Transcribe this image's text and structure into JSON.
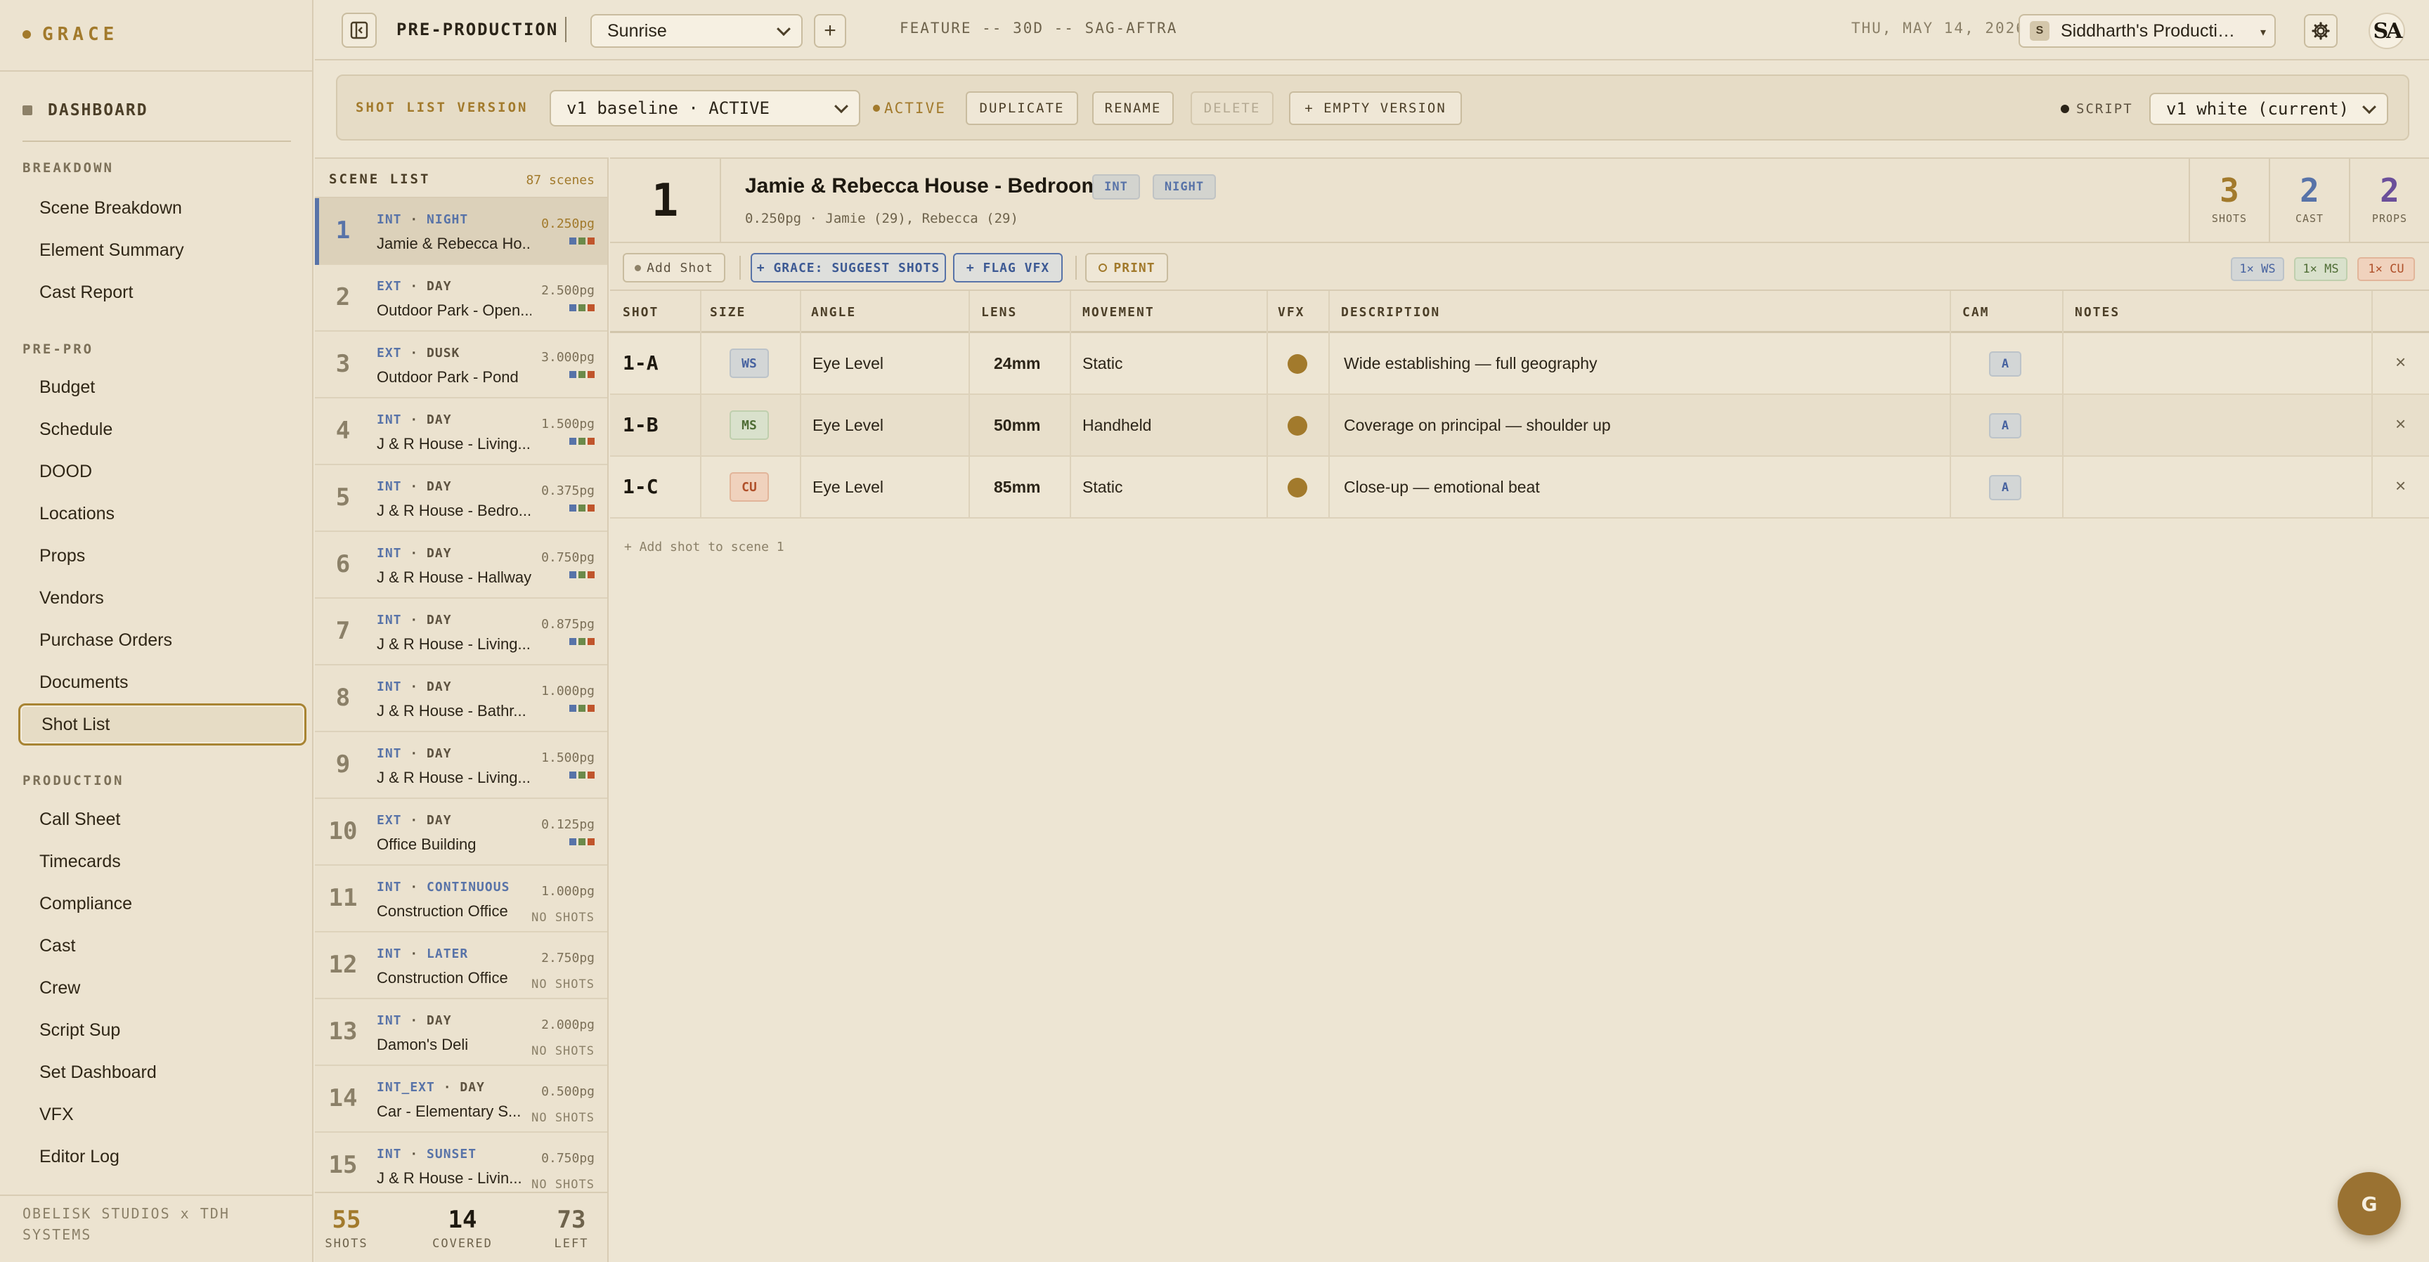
{
  "app": {
    "brand": "GRACE",
    "dashboard": "DASHBOARD"
  },
  "sidebar": {
    "sections": [
      {
        "title": "BREAKDOWN",
        "items": [
          "Scene Breakdown",
          "Element Summary",
          "Cast Report"
        ]
      },
      {
        "title": "PRE-PRO",
        "items": [
          "Budget",
          "Schedule",
          "DOOD",
          "Locations",
          "Props",
          "Vendors",
          "Purchase Orders",
          "Documents",
          "Shot List"
        ]
      },
      {
        "title": "PRODUCTION",
        "items": [
          "Call Sheet",
          "Timecards",
          "Compliance",
          "Cast",
          "Crew",
          "Script Sup",
          "Set Dashboard",
          "VFX",
          "Editor Log"
        ]
      }
    ],
    "active_item": "Shot List",
    "footer": "OBELISK STUDIOS x TDH SYSTEMS"
  },
  "topbar": {
    "section": "PRE-PRODUCTION",
    "project": "Sunrise",
    "add_label": "+",
    "feature": "FEATURE -- 30D -- SAG-AFTRA",
    "date": "THU, MAY 14, 2026",
    "production_initial": "S",
    "production": "Siddharth's Producti…",
    "production_caret": "▾",
    "user_initials": "SA",
    "icons": [
      "sidebar-toggle-icon",
      "gear-icon"
    ]
  },
  "version_bar": {
    "label": "SHOT LIST VERSION",
    "version": "v1 baseline · ACTIVE",
    "status": "ACTIVE",
    "buttons": {
      "duplicate": "DUPLICATE",
      "rename": "RENAME",
      "delete": "DELETE",
      "empty_version": "+ EMPTY VERSION"
    },
    "script_label": "SCRIPT",
    "script": "v1 white (current)"
  },
  "scene_list": {
    "title": "SCENE LIST",
    "count": "87 scenes",
    "scenes": [
      {
        "num": "1",
        "ie": "INT",
        "tod": "NIGHT",
        "name": "Jamie & Rebecca Ho...",
        "pages": "0.250pg",
        "status": "bars"
      },
      {
        "num": "2",
        "ie": "EXT",
        "tod": "DAY",
        "name": "Outdoor Park - Open...",
        "pages": "2.500pg",
        "status": "bars"
      },
      {
        "num": "3",
        "ie": "EXT",
        "tod": "DUSK",
        "name": "Outdoor Park - Pond",
        "pages": "3.000pg",
        "status": "bars"
      },
      {
        "num": "4",
        "ie": "INT",
        "tod": "DAY",
        "name": "J & R House - Living...",
        "pages": "1.500pg",
        "status": "bars"
      },
      {
        "num": "5",
        "ie": "INT",
        "tod": "DAY",
        "name": "J & R House - Bedro...",
        "pages": "0.375pg",
        "status": "bars"
      },
      {
        "num": "6",
        "ie": "INT",
        "tod": "DAY",
        "name": "J & R House - Hallway",
        "pages": "0.750pg",
        "status": "bars"
      },
      {
        "num": "7",
        "ie": "INT",
        "tod": "DAY",
        "name": "J & R House - Living...",
        "pages": "0.875pg",
        "status": "bars"
      },
      {
        "num": "8",
        "ie": "INT",
        "tod": "DAY",
        "name": "J & R House - Bathr...",
        "pages": "1.000pg",
        "status": "bars"
      },
      {
        "num": "9",
        "ie": "INT",
        "tod": "DAY",
        "name": "J & R House - Living...",
        "pages": "1.500pg",
        "status": "bars"
      },
      {
        "num": "10",
        "ie": "EXT",
        "tod": "DAY",
        "name": "Office Building",
        "pages": "0.125pg",
        "status": "bars"
      },
      {
        "num": "11",
        "ie": "INT",
        "tod": "CONTINUOUS",
        "name": "Construction Office",
        "pages": "1.000pg",
        "status": "NO SHOTS"
      },
      {
        "num": "12",
        "ie": "INT",
        "tod": "LATER",
        "name": "Construction Office",
        "pages": "2.750pg",
        "status": "NO SHOTS"
      },
      {
        "num": "13",
        "ie": "INT",
        "tod": "DAY",
        "name": "Damon's Deli",
        "pages": "2.000pg",
        "status": "NO SHOTS"
      },
      {
        "num": "14",
        "ie": "INT_EXT",
        "tod": "DAY",
        "name": "Car - Elementary S...",
        "pages": "0.500pg",
        "status": "NO SHOTS"
      },
      {
        "num": "15",
        "ie": "INT",
        "tod": "SUNSET",
        "name": "J & R House - Livin...",
        "pages": "0.750pg",
        "status": "NO SHOTS"
      }
    ],
    "footer": {
      "shots": "55",
      "shots_label": "SHOTS",
      "covered": "14",
      "covered_label": "COVERED",
      "left": "73",
      "left_label": "LEFT"
    }
  },
  "scene": {
    "num": "1",
    "title": "Jamie & Rebecca House - Bedroom",
    "tags": [
      "INT",
      "NIGHT"
    ],
    "subtitle": "0.250pg · Jamie (29), Rebecca (29)",
    "stats": [
      {
        "value": "3",
        "label": "SHOTS",
        "color": "#a27a2c"
      },
      {
        "value": "2",
        "label": "CAST",
        "color": "#5873a8"
      },
      {
        "value": "2",
        "label": "PROPS",
        "color": "#6b4f9a"
      }
    ]
  },
  "toolbar": {
    "add_shot": "Add Shot",
    "suggest": "+ GRACE: SUGGEST SHOTS",
    "flag_vfx": "+ FLAG VFX",
    "print": "PRINT",
    "summary": [
      "1× WS",
      "1× MS",
      "1× CU"
    ]
  },
  "table": {
    "columns": [
      "SHOT",
      "SIZE",
      "ANGLE",
      "LENS",
      "MOVEMENT",
      "VFX",
      "DESCRIPTION",
      "CAM",
      "NOTES"
    ],
    "rows": [
      {
        "shot": "1-A",
        "size": "WS",
        "angle": "Eye Level",
        "lens": "24mm",
        "movement": "Static",
        "description": "Wide establishing — full geography",
        "cam": "A",
        "notes": ""
      },
      {
        "shot": "1-B",
        "size": "MS",
        "angle": "Eye Level",
        "lens": "50mm",
        "movement": "Handheld",
        "description": "Coverage on principal — shoulder up",
        "cam": "A",
        "notes": ""
      },
      {
        "shot": "1-C",
        "size": "CU",
        "angle": "Eye Level",
        "lens": "85mm",
        "movement": "Static",
        "description": "Close-up — emotional beat",
        "cam": "A",
        "notes": ""
      }
    ],
    "delete_label": "×",
    "add_row": "+ Add shot to scene 1"
  },
  "fab": {
    "label": "G"
  }
}
